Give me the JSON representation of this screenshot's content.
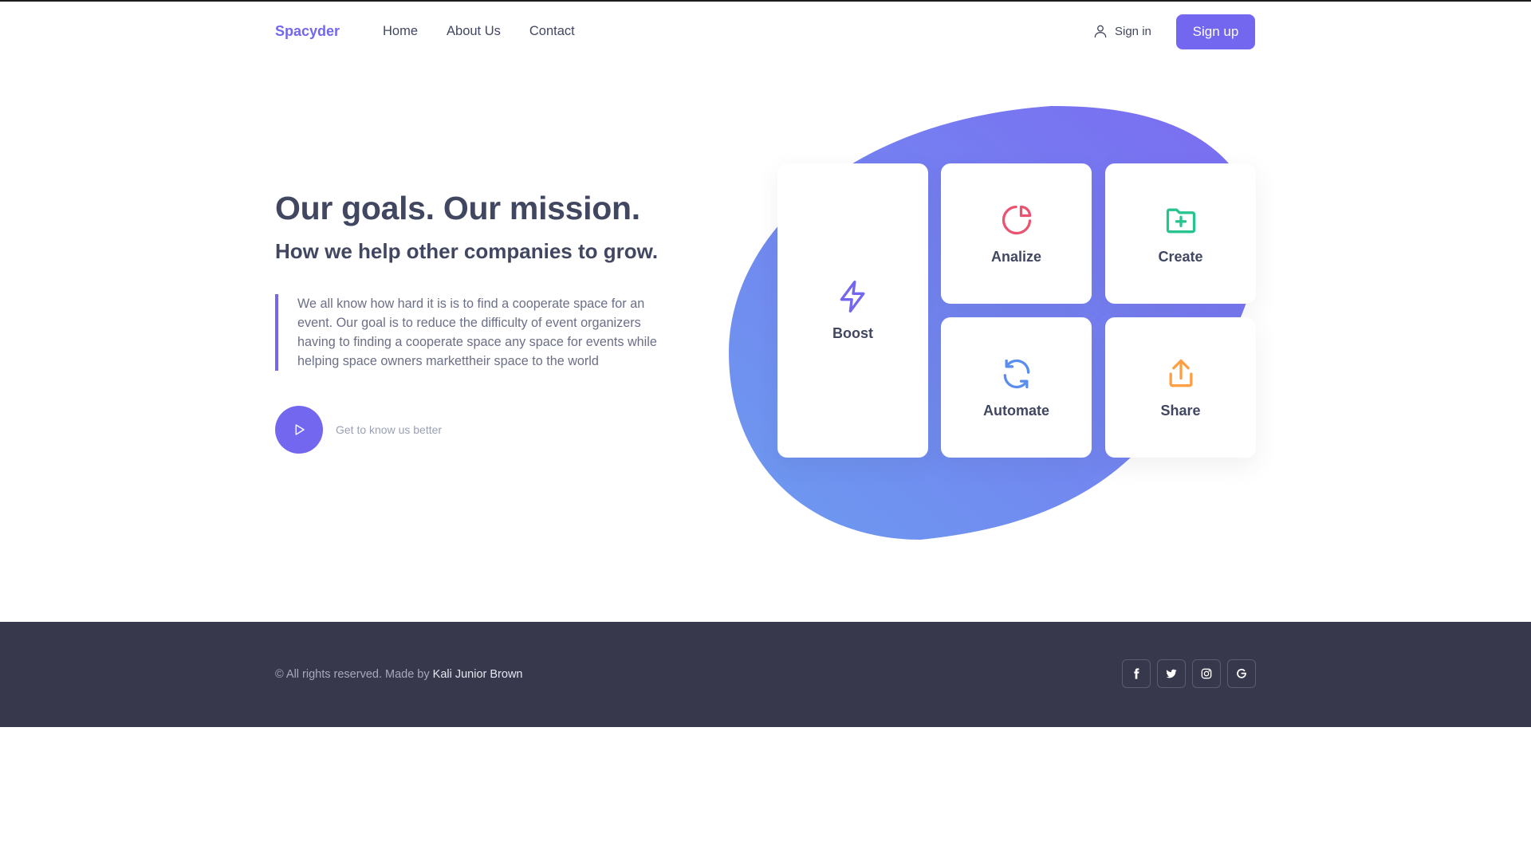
{
  "header": {
    "logo": "Spacyder",
    "nav": [
      {
        "label": "Home"
      },
      {
        "label": "About Us"
      },
      {
        "label": "Contact"
      }
    ],
    "signin_label": "Sign in",
    "signup_label": "Sign up"
  },
  "hero": {
    "title": "Our goals. Our mission.",
    "subtitle": "How we help other companies to grow.",
    "description": "We all know how hard it is is to find a cooperate space for an event. Our goal is to reduce the difficulty of event organizers having to finding a cooperate space any space for events while helping space owners markettheir space to the world",
    "cta_label": "Get to know us better"
  },
  "features": [
    {
      "label": "Boost",
      "icon": "lightning-icon",
      "color": "#7367f0"
    },
    {
      "label": "Analize",
      "icon": "pie-chart-icon",
      "color": "#ea5471"
    },
    {
      "label": "Create",
      "icon": "folder-plus-icon",
      "color": "#28c48f"
    },
    {
      "label": "Automate",
      "icon": "refresh-icon",
      "color": "#5b8def"
    },
    {
      "label": "Share",
      "icon": "share-upload-icon",
      "color": "#ff9f43"
    }
  ],
  "footer": {
    "copyright_prefix": "© All rights reserved. Made by ",
    "author": "Kali Junior Brown",
    "socials": [
      "facebook-icon",
      "twitter-icon",
      "instagram-icon",
      "google-icon"
    ]
  },
  "colors": {
    "accent": "#7367f0",
    "text": "#424761",
    "footer_bg": "#37384c",
    "blob_start": "#6c9bf0",
    "blob_end": "#7b6cf1"
  }
}
